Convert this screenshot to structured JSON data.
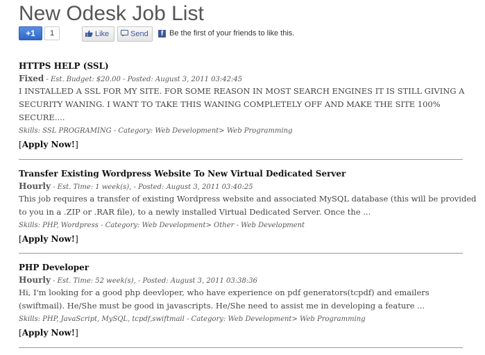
{
  "page": {
    "title": "New Odesk Job List"
  },
  "social": {
    "gplus_label": "+1",
    "gplus_count": "1",
    "like_label": "Like",
    "send_label": "Send",
    "fb_logo": "f",
    "fb_text": "Be the first of your friends to like this.",
    "colors": {
      "facebook": "#3b5998",
      "gplus": "#3d78d8"
    }
  },
  "jobs": [
    {
      "title": "HTTPS HELP (SSL)",
      "type": "Fixed",
      "meta": " - Est. Budget: $20.00 - Posted: August 3, 2011 03:42:45",
      "description": [
        "I INSTALLED A SSL FOR MY SITE. FOR SOME REASON IN MOST SEARCH ENGINES IT IS STILL GIVING A",
        "SECURITY WANING. I WANT TO TAKE THIS WANING COMPLETELY OFF AND MAKE THE SITE 100%",
        "SECURE...."
      ],
      "skills": "Skills: SSL PROGRAMING - Category: Web Development> Web Programming",
      "apply_open": "[",
      "apply_label": "Apply Now!",
      "apply_close": "]"
    },
    {
      "title": "Transfer Existing Wordpress Website To New Virtual Dedicated Server",
      "type": "Hourly",
      "meta": " - Est. Time: 1 week(s), - Posted: August 3, 2011 03:40:25",
      "description": [
        "This job requires a transfer of existing Wordpress website and associated MySQL database (this will be provided",
        "to you in a .ZIP or .RAR file), to a newly installed Virtual Dedicated Server. Once the ..."
      ],
      "skills": "Skills: PHP, Wordpress - Category: Web Development> Other - Web Development",
      "apply_open": "[",
      "apply_label": "Apply Now!",
      "apply_close": "]"
    },
    {
      "title": "PHP Developer",
      "type": "Hourly",
      "meta": " - Est. Time: 52 week(s), - Posted: August 3, 2011 03:38:36",
      "description": [
        "Hi, I'm looking for a good php deevloper, who have experience on pdf generators(tcpdf) and emailers",
        "(swiftmail). He/She must be good in javascripts. He/She need to assist me in developing a feature ..."
      ],
      "skills": "Skills: PHP, JavaScript, MySQL, tcpdf,swiftmail - Category: Web Development> Web Programming",
      "apply_open": "[",
      "apply_label": "Apply Now!",
      "apply_close": "]"
    }
  ]
}
